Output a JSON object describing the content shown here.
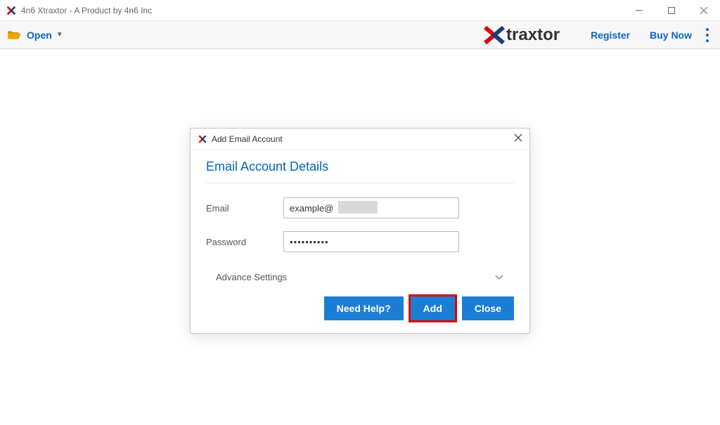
{
  "window": {
    "title": "4n6 Xtraxtor - A Product by 4n6 Inc"
  },
  "toolbar": {
    "open_label": "Open",
    "brand_text": "traxtor",
    "register_label": "Register",
    "buy_now_label": "Buy Now"
  },
  "modal": {
    "title": "Add Email Account",
    "section_title": "Email Account Details",
    "email_label": "Email",
    "email_value": "example@",
    "password_label": "Password",
    "password_value": "••••••••••",
    "advance_label": "Advance Settings",
    "need_help_label": "Need Help?",
    "add_label": "Add",
    "close_label": "Close"
  }
}
